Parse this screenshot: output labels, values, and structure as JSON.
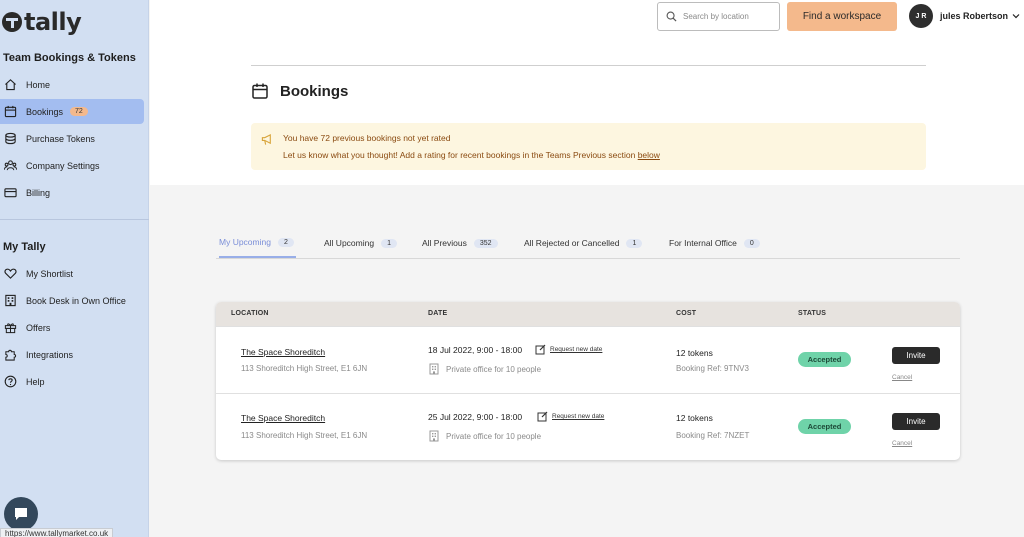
{
  "brand": {
    "name": "tally"
  },
  "sidebar": {
    "section1_title": "Team Bookings & Tokens",
    "section1_items": [
      {
        "label": "Home",
        "icon": "home-icon"
      },
      {
        "label": "Bookings",
        "icon": "calendar-icon",
        "badge": "72",
        "active": true
      },
      {
        "label": "Purchase Tokens",
        "icon": "coins-icon"
      },
      {
        "label": "Company Settings",
        "icon": "team-icon"
      },
      {
        "label": "Billing",
        "icon": "card-icon"
      }
    ],
    "section2_title": "My Tally",
    "section2_items": [
      {
        "label": "My Shortlist",
        "icon": "heart-icon"
      },
      {
        "label": "Book Desk in Own Office",
        "icon": "building-icon"
      },
      {
        "label": "Offers",
        "icon": "gift-icon"
      },
      {
        "label": "Integrations",
        "icon": "puzzle-icon"
      },
      {
        "label": "Help",
        "icon": "help-icon"
      }
    ]
  },
  "header": {
    "search_placeholder": "Search by location",
    "find_button": "Find a workspace",
    "user_initials": "J R",
    "user_name": "jules Robertson"
  },
  "page": {
    "title": "Bookings"
  },
  "notice": {
    "title": "You have 72 previous bookings not yet rated",
    "text": "Let us know what you thought! Add a rating for recent bookings in the Teams Previous section ",
    "link": "below"
  },
  "tabs": [
    {
      "label": "My Upcoming",
      "count": "2",
      "active": true
    },
    {
      "label": "All Upcoming",
      "count": "1"
    },
    {
      "label": "All Previous",
      "count": "352"
    },
    {
      "label": "All Rejected or Cancelled",
      "count": "1"
    },
    {
      "label": "For Internal Office",
      "count": "0"
    }
  ],
  "table": {
    "columns": [
      "LOCATION",
      "DATE",
      "COST",
      "STATUS"
    ],
    "rows": [
      {
        "location": "The Space Shoreditch",
        "address": "113 Shoreditch High Street, E1 6JN",
        "date": "18 Jul 2022, 9:00 - 18:00",
        "request_link": "Request new date",
        "office": "Private office for 10 people",
        "cost": "12 tokens",
        "ref": "Booking Ref: 9TNV3",
        "status": "Accepted",
        "invite": "Invite",
        "cancel": "Cancel"
      },
      {
        "location": "The Space Shoreditch",
        "address": "113 Shoreditch High Street, E1 6JN",
        "date": "25 Jul 2022, 9:00 - 18:00",
        "request_link": "Request new date",
        "office": "Private office for 10 people",
        "cost": "12 tokens",
        "ref": "Booking Ref: 7NZET",
        "status": "Accepted",
        "invite": "Invite",
        "cancel": "Cancel"
      }
    ]
  },
  "status_bar": {
    "url": "https://www.tallymarket.co.uk"
  },
  "colors": {
    "sidebar_bg": "#d2dff2",
    "active_nav": "#a3bdf0",
    "accent_button": "#f4b98c",
    "status_accepted": "#6fd3a9",
    "notice_bg": "#fdf6e0"
  }
}
